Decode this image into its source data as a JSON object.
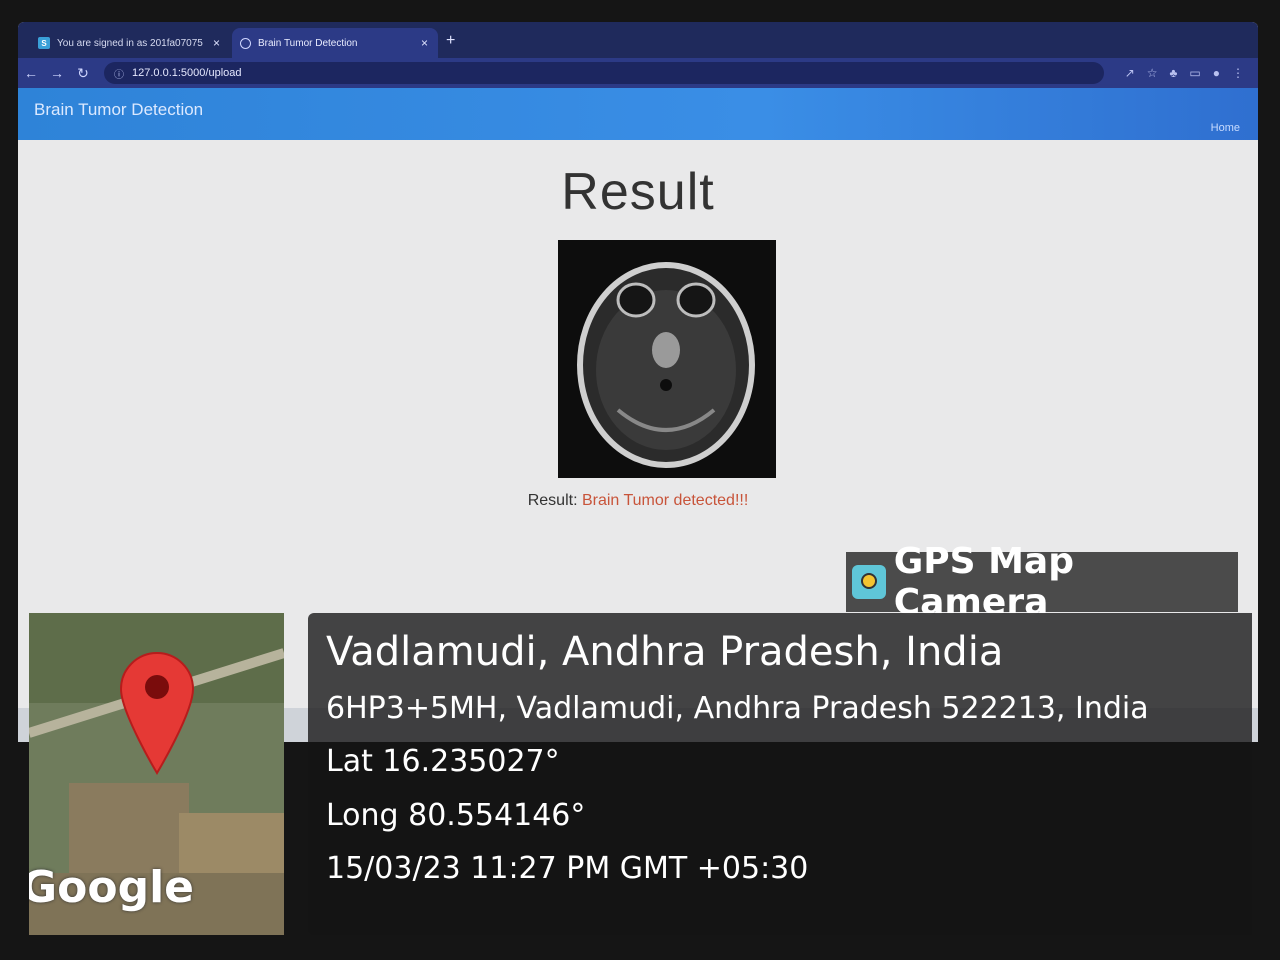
{
  "browser": {
    "tabs": [
      {
        "title": "You are signed in as 201fa07075",
        "icon": "s-favicon",
        "active": false
      },
      {
        "title": "Brain Tumor Detection",
        "icon": "globe-favicon",
        "active": true
      }
    ],
    "close_glyph": "×",
    "new_tab_glyph": "+",
    "url": "127.0.0.1:5000/upload"
  },
  "app": {
    "brand": "Brain Tumor Detection",
    "nav_home": "Home",
    "page_title": "Result",
    "result_label": "Result:",
    "result_value": "Brain Tumor detected!!!",
    "colors": {
      "navbar": "#2e83d8",
      "result_value": "#c8543a"
    }
  },
  "overlay": {
    "app_name": "GPS Map Camera",
    "location_name": "Vadlamudi, Andhra Pradesh, India",
    "address": "6HP3+5MH, Vadlamudi, Andhra Pradesh 522213, India",
    "latitude": "Lat 16.235027°",
    "longitude": "Long 80.554146°",
    "timestamp": "15/03/23 11:27 PM GMT +05:30",
    "map_brand": "Google"
  }
}
